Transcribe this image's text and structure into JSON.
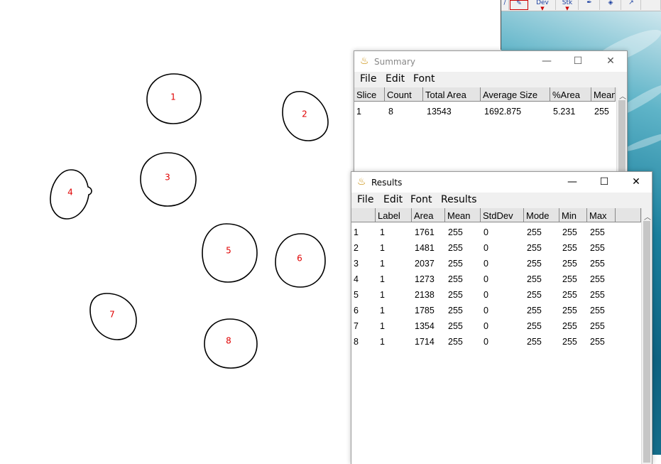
{
  "toolbar": {
    "buttons": [
      {
        "label": "Dev"
      },
      {
        "label": "Stk"
      }
    ],
    "arrow": "▼"
  },
  "canvas": {
    "cells": [
      {
        "label": "1"
      },
      {
        "label": "2"
      },
      {
        "label": "3"
      },
      {
        "label": "4"
      },
      {
        "label": "5"
      },
      {
        "label": "6"
      },
      {
        "label": "7"
      },
      {
        "label": "8"
      }
    ]
  },
  "summary": {
    "title": "Summary",
    "menu": [
      "File",
      "Edit",
      "Font"
    ],
    "headers": [
      "Slice",
      "Count",
      "Total Area",
      "Average Size",
      "%Area",
      "Mean"
    ],
    "rows": [
      [
        "1",
        "8",
        "13543",
        "1692.875",
        "5.231",
        "255"
      ]
    ]
  },
  "results": {
    "title": "Results",
    "menu": [
      "File",
      "Edit",
      "Font",
      "Results"
    ],
    "headers": [
      "",
      "Label",
      "Area",
      "Mean",
      "StdDev",
      "Mode",
      "Min",
      "Max"
    ],
    "rows": [
      [
        "1",
        "1",
        "1761",
        "255",
        "0",
        "255",
        "255",
        "255"
      ],
      [
        "2",
        "1",
        "1481",
        "255",
        "0",
        "255",
        "255",
        "255"
      ],
      [
        "3",
        "1",
        "2037",
        "255",
        "0",
        "255",
        "255",
        "255"
      ],
      [
        "4",
        "1",
        "1273",
        "255",
        "0",
        "255",
        "255",
        "255"
      ],
      [
        "5",
        "1",
        "2138",
        "255",
        "0",
        "255",
        "255",
        "255"
      ],
      [
        "6",
        "1",
        "1785",
        "255",
        "0",
        "255",
        "255",
        "255"
      ],
      [
        "7",
        "1",
        "1354",
        "255",
        "0",
        "255",
        "255",
        "255"
      ],
      [
        "8",
        "1",
        "1714",
        "255",
        "0",
        "255",
        "255",
        "255"
      ]
    ]
  },
  "window_controls": {
    "minimize": "—",
    "maximize": "☐",
    "close": "✕"
  },
  "icons": {
    "app": "microscope-icon",
    "scroll_up": "chevron-up-icon"
  },
  "colors": {
    "cell_label": "#e00000",
    "outline": "#000000"
  }
}
